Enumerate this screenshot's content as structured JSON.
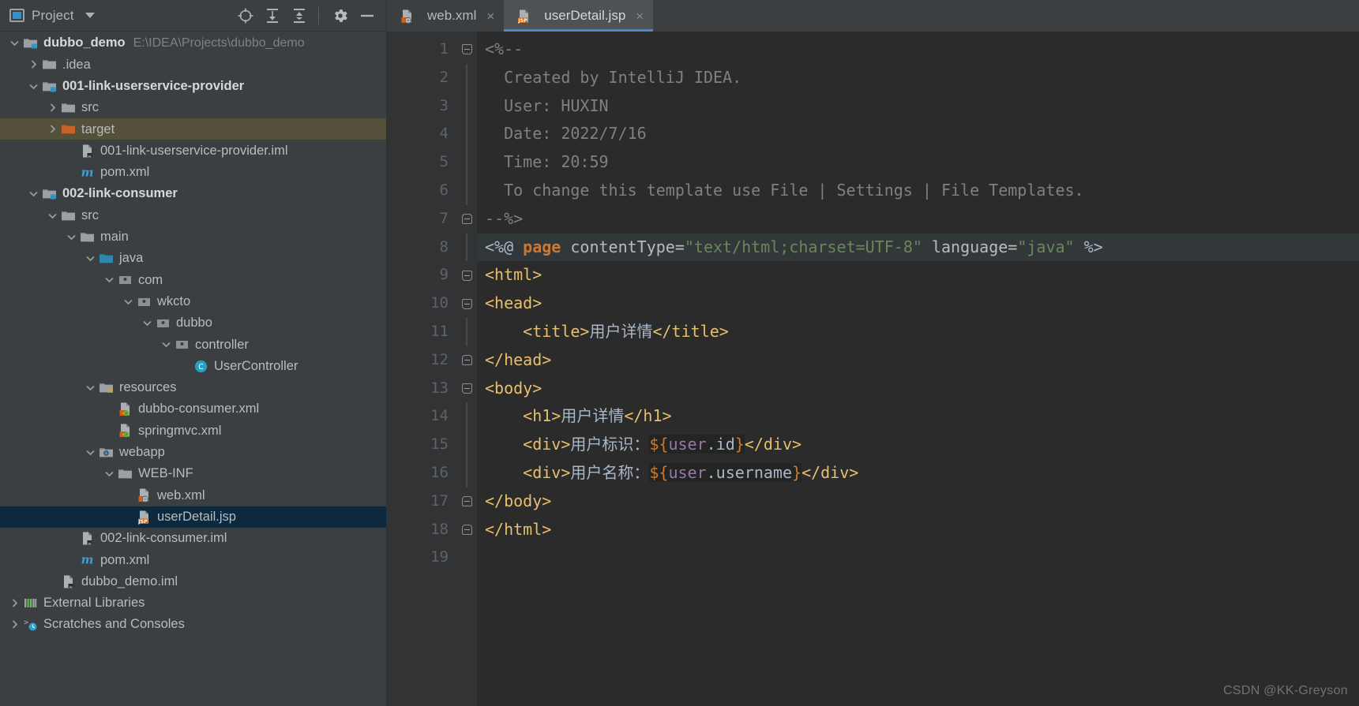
{
  "sidebar": {
    "title": "Project",
    "icons": [
      "project-badge-icon",
      "chevron-down-icon",
      "locate-icon",
      "expand-all-icon",
      "collapse-all-icon",
      "settings-gear-icon",
      "hide-icon"
    ],
    "tree": [
      {
        "label": "dubbo_demo",
        "detail": "E:\\IDEA\\Projects\\dubbo_demo",
        "indent": 0,
        "arrow": "expanded",
        "icon": "module-folder-icon",
        "bold": true,
        "state": "normal"
      },
      {
        "label": ".idea",
        "detail": "",
        "indent": 1,
        "arrow": "collapsed",
        "icon": "folder-icon",
        "bold": false,
        "state": "normal"
      },
      {
        "label": "001-link-userservice-provider",
        "detail": "",
        "indent": 1,
        "arrow": "expanded",
        "icon": "module-folder-icon",
        "bold": true,
        "state": "normal"
      },
      {
        "label": "src",
        "detail": "",
        "indent": 2,
        "arrow": "collapsed",
        "icon": "folder-icon",
        "bold": false,
        "state": "normal"
      },
      {
        "label": "target",
        "detail": "",
        "indent": 2,
        "arrow": "collapsed",
        "icon": "folder-orange-icon",
        "bold": false,
        "state": "olive"
      },
      {
        "label": "001-link-userservice-provider.iml",
        "detail": "",
        "indent": 3,
        "arrow": "none",
        "icon": "iml-file-icon",
        "bold": false,
        "state": "normal"
      },
      {
        "label": "pom.xml",
        "detail": "",
        "indent": 3,
        "arrow": "none",
        "icon": "maven-icon",
        "bold": false,
        "state": "normal"
      },
      {
        "label": "002-link-consumer",
        "detail": "",
        "indent": 1,
        "arrow": "expanded",
        "icon": "module-folder-icon",
        "bold": true,
        "state": "normal"
      },
      {
        "label": "src",
        "detail": "",
        "indent": 2,
        "arrow": "expanded",
        "icon": "folder-icon",
        "bold": false,
        "state": "normal"
      },
      {
        "label": "main",
        "detail": "",
        "indent": 3,
        "arrow": "expanded",
        "icon": "folder-icon",
        "bold": false,
        "state": "normal"
      },
      {
        "label": "java",
        "detail": "",
        "indent": 4,
        "arrow": "expanded",
        "icon": "source-root-icon",
        "bold": false,
        "state": "normal"
      },
      {
        "label": "com",
        "detail": "",
        "indent": 5,
        "arrow": "expanded",
        "icon": "package-icon",
        "bold": false,
        "state": "normal"
      },
      {
        "label": "wkcto",
        "detail": "",
        "indent": 6,
        "arrow": "expanded",
        "icon": "package-icon",
        "bold": false,
        "state": "normal"
      },
      {
        "label": "dubbo",
        "detail": "",
        "indent": 7,
        "arrow": "expanded",
        "icon": "package-icon",
        "bold": false,
        "state": "normal"
      },
      {
        "label": "controller",
        "detail": "",
        "indent": 8,
        "arrow": "expanded",
        "icon": "package-icon",
        "bold": false,
        "state": "normal"
      },
      {
        "label": "UserController",
        "detail": "",
        "indent": 9,
        "arrow": "none",
        "icon": "java-class-icon",
        "bold": false,
        "state": "normal"
      },
      {
        "label": "resources",
        "detail": "",
        "indent": 4,
        "arrow": "expanded",
        "icon": "resources-folder-icon",
        "bold": false,
        "state": "normal"
      },
      {
        "label": "dubbo-consumer.xml",
        "detail": "",
        "indent": 5,
        "arrow": "none",
        "icon": "spring-xml-icon",
        "bold": false,
        "state": "normal"
      },
      {
        "label": "springmvc.xml",
        "detail": "",
        "indent": 5,
        "arrow": "none",
        "icon": "spring-xml-icon",
        "bold": false,
        "state": "normal"
      },
      {
        "label": "webapp",
        "detail": "",
        "indent": 4,
        "arrow": "expanded",
        "icon": "webapp-folder-icon",
        "bold": false,
        "state": "normal"
      },
      {
        "label": "WEB-INF",
        "detail": "",
        "indent": 5,
        "arrow": "expanded",
        "icon": "folder-icon",
        "bold": false,
        "state": "normal"
      },
      {
        "label": "web.xml",
        "detail": "",
        "indent": 6,
        "arrow": "none",
        "icon": "web-xml-icon",
        "bold": false,
        "state": "normal"
      },
      {
        "label": "userDetail.jsp",
        "detail": "",
        "indent": 6,
        "arrow": "none",
        "icon": "jsp-file-icon",
        "bold": false,
        "state": "selected"
      },
      {
        "label": "002-link-consumer.iml",
        "detail": "",
        "indent": 3,
        "arrow": "none",
        "icon": "iml-file-icon",
        "bold": false,
        "state": "normal"
      },
      {
        "label": "pom.xml",
        "detail": "",
        "indent": 3,
        "arrow": "none",
        "icon": "maven-icon",
        "bold": false,
        "state": "normal"
      },
      {
        "label": "dubbo_demo.iml",
        "detail": "",
        "indent": 2,
        "arrow": "none",
        "icon": "iml-file-icon",
        "bold": false,
        "state": "normal"
      },
      {
        "label": "External Libraries",
        "detail": "",
        "indent": 0,
        "arrow": "collapsed",
        "icon": "libraries-icon",
        "bold": false,
        "state": "normal"
      },
      {
        "label": "Scratches and Consoles",
        "detail": "",
        "indent": 0,
        "arrow": "collapsed",
        "icon": "scratches-icon",
        "bold": false,
        "state": "normal"
      }
    ]
  },
  "editor": {
    "tabs": [
      {
        "label": "web.xml",
        "icon": "web-xml-icon",
        "active": false,
        "close": "×"
      },
      {
        "label": "userDetail.jsp",
        "icon": "jsp-file-icon",
        "active": true,
        "close": "×"
      }
    ],
    "line_numbers": [
      "1",
      "2",
      "3",
      "4",
      "5",
      "6",
      "7",
      "8",
      "9",
      "10",
      "11",
      "12",
      "13",
      "14",
      "15",
      "16",
      "17",
      "18",
      "19"
    ],
    "lines": [
      {
        "n": 1,
        "fold": "start",
        "highlight": false,
        "tokens": [
          {
            "t": "<%--",
            "c": "comment"
          }
        ]
      },
      {
        "n": 2,
        "fold": "bar",
        "highlight": false,
        "tokens": [
          {
            "t": "  Created by IntelliJ IDEA.",
            "c": "comment"
          }
        ]
      },
      {
        "n": 3,
        "fold": "bar",
        "highlight": false,
        "tokens": [
          {
            "t": "  User: HUXIN",
            "c": "comment"
          }
        ]
      },
      {
        "n": 4,
        "fold": "bar",
        "highlight": false,
        "tokens": [
          {
            "t": "  Date: 2022/7/16",
            "c": "comment"
          }
        ]
      },
      {
        "n": 5,
        "fold": "bar",
        "highlight": false,
        "tokens": [
          {
            "t": "  Time: 20:59",
            "c": "comment"
          }
        ]
      },
      {
        "n": 6,
        "fold": "bar",
        "highlight": false,
        "tokens": [
          {
            "t": "  To change this template use File | Settings | File Templates.",
            "c": "comment"
          }
        ]
      },
      {
        "n": 7,
        "fold": "end",
        "highlight": false,
        "tokens": [
          {
            "t": "--%>",
            "c": "comment"
          }
        ]
      },
      {
        "n": 8,
        "fold": "bar",
        "highlight": true,
        "tokens": [
          {
            "t": "<%@ ",
            "c": "punct"
          },
          {
            "t": "page",
            "c": "kw"
          },
          {
            "t": " contentType=",
            "c": "attr"
          },
          {
            "t": "\"text/html;charset=UTF-8\"",
            "c": "str-q"
          },
          {
            "t": " language=",
            "c": "attr"
          },
          {
            "t": "\"java\"",
            "c": "str-q"
          },
          {
            "t": " %>",
            "c": "punct"
          }
        ]
      },
      {
        "n": 9,
        "fold": "start",
        "highlight": false,
        "tokens": [
          {
            "t": "<html>",
            "c": "tag"
          }
        ]
      },
      {
        "n": 10,
        "fold": "start",
        "highlight": false,
        "tokens": [
          {
            "t": "<head>",
            "c": "tag"
          }
        ]
      },
      {
        "n": 11,
        "fold": "bar",
        "highlight": false,
        "tokens": [
          {
            "t": "    <title>",
            "c": "tag"
          },
          {
            "t": "用户详情",
            "c": "text"
          },
          {
            "t": "</title>",
            "c": "tag"
          }
        ]
      },
      {
        "n": 12,
        "fold": "end",
        "highlight": false,
        "tokens": [
          {
            "t": "</head>",
            "c": "tag"
          }
        ]
      },
      {
        "n": 13,
        "fold": "start",
        "highlight": false,
        "tokens": [
          {
            "t": "<body>",
            "c": "tag"
          }
        ]
      },
      {
        "n": 14,
        "fold": "bar",
        "highlight": false,
        "tokens": [
          {
            "t": "    <h1>",
            "c": "tag"
          },
          {
            "t": "用户详情",
            "c": "text"
          },
          {
            "t": "</h1>",
            "c": "tag"
          }
        ]
      },
      {
        "n": 15,
        "fold": "bar",
        "highlight": false,
        "tokens": [
          {
            "t": "    <div>",
            "c": "tag"
          },
          {
            "t": "用户标识：",
            "c": "text"
          },
          {
            "t": "${",
            "c": "el-sym"
          },
          {
            "t": "user",
            "c": "el-id"
          },
          {
            "t": ".id",
            "c": "el-prop"
          },
          {
            "t": "}",
            "c": "el-sym"
          },
          {
            "t": "</div>",
            "c": "tag"
          }
        ]
      },
      {
        "n": 16,
        "fold": "bar",
        "highlight": false,
        "tokens": [
          {
            "t": "    <div>",
            "c": "tag"
          },
          {
            "t": "用户名称：",
            "c": "text"
          },
          {
            "t": "${",
            "c": "el-sym"
          },
          {
            "t": "user",
            "c": "el-id"
          },
          {
            "t": ".username",
            "c": "el-prop"
          },
          {
            "t": "}",
            "c": "el-sym"
          },
          {
            "t": "</div>",
            "c": "tag"
          }
        ]
      },
      {
        "n": 17,
        "fold": "end",
        "highlight": false,
        "tokens": [
          {
            "t": "</body>",
            "c": "tag"
          }
        ]
      },
      {
        "n": 18,
        "fold": "end",
        "highlight": false,
        "tokens": [
          {
            "t": "</html>",
            "c": "tag"
          }
        ]
      },
      {
        "n": 19,
        "fold": "none",
        "highlight": false,
        "tokens": []
      }
    ]
  },
  "watermark": "CSDN @KK-Greyson",
  "colors": {
    "panel_bg": "#3c3f41",
    "editor_bg": "#2b2b2b",
    "gutter_bg": "#313335",
    "accent_blue": "#3592c4",
    "tab_active_underline": "#4a88c7",
    "selection_blue": "#0d293e",
    "selection_olive": "#55503a",
    "tag_orange": "#e8bf6a",
    "string_green": "#6a8759",
    "keyword_orange": "#cc7832",
    "comment_gray": "#808080",
    "el_purple": "#9876aa"
  }
}
